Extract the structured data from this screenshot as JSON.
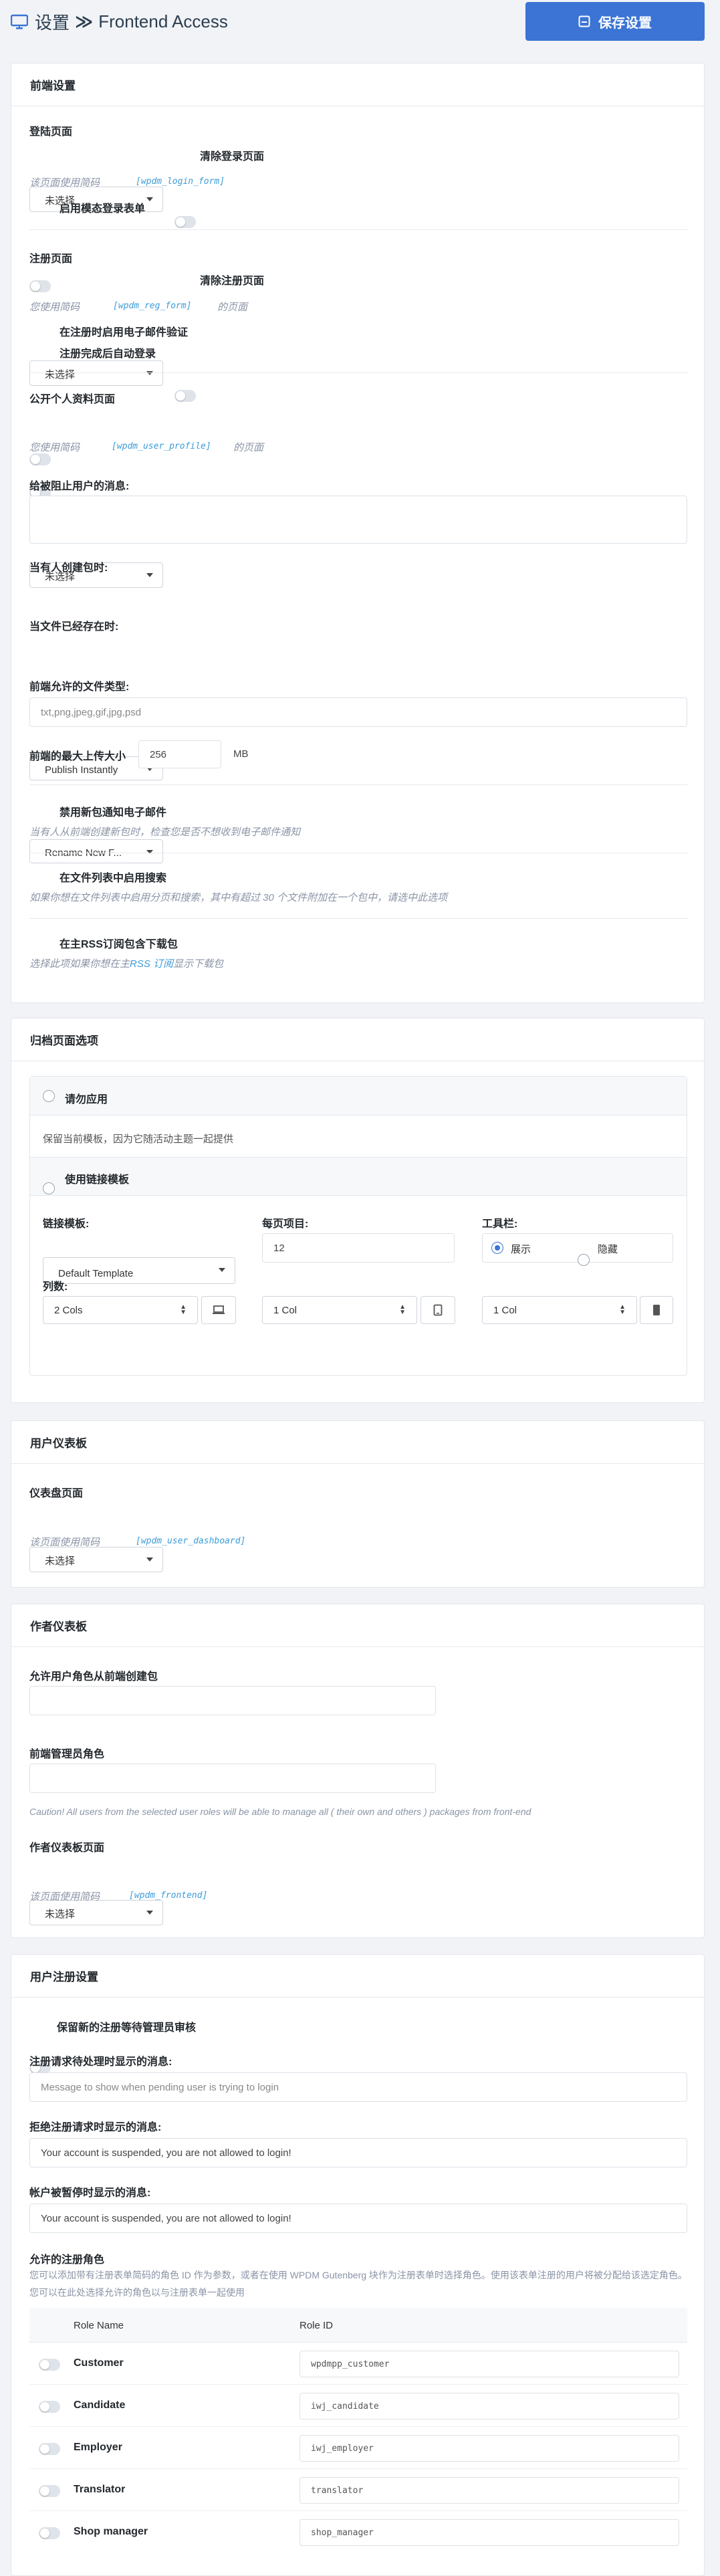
{
  "header": {
    "title_prefix": "设置",
    "title_separator": "≫",
    "title": "Frontend Access",
    "save_label": "保存设置",
    "accent": "#3b74d4"
  },
  "frontend": {
    "section_title": "前端设置",
    "login": {
      "label": "登陆页面",
      "select_value": "未选择",
      "clear_label": "清除登录页面",
      "help": "该页面使用简码",
      "shortcode": "[wpdm_login_form]",
      "modal_label": "启用模态登录表单"
    },
    "register": {
      "label": "注册页面",
      "select_value": "未选择",
      "clear_label": "清除注册页面",
      "help_prefix": "您使用简码",
      "shortcode": "[wpdm_reg_form]",
      "help_suffix": "的页面",
      "email_verify_label": "在注册时启用电子邮件验证",
      "auto_login_label": "注册完成后自动登录"
    },
    "profile": {
      "label": "公开个人资料页面",
      "select_value": "未选择",
      "help_prefix": "您使用简码",
      "shortcode": "[wpdm_user_profile]",
      "help_suffix": "的页面"
    },
    "blocked_msg_label": "给被阻止用户的消息:",
    "create_pkg": {
      "label": "当有人创建包时:",
      "value": "Publish Instantly"
    },
    "file_exists": {
      "label": "当文件已经存在时:",
      "value": "Rename New F..."
    },
    "file_types": {
      "label": "前端允许的文件类型:",
      "value": "txt,png,jpeg,gif,jpg,psd"
    },
    "max_upload": {
      "label": "前端的最大上传大小",
      "value": "256",
      "unit": "MB"
    },
    "new_pkg_email": {
      "label": "禁用新包通知电子邮件",
      "help": "当有人从前端创建新包时，检查您是否不想收到电子邮件通知"
    },
    "file_search": {
      "label": "在文件列表中启用搜索",
      "help": "如果你想在文件列表中启用分页和搜索，其中有超过 30 个文件附加在一个包中，请选中此选项"
    },
    "rss": {
      "label": "在主RSS订阅包含下载包",
      "help_prefix": "选择此项如果你想在主",
      "help_link": "RSS 订阅",
      "help_suffix": "显示下载包"
    }
  },
  "archive": {
    "section_title": "归档页面选项",
    "opt1_label": "请勿应用",
    "opt1_desc": "保留当前模板，因为它随活动主题一起提供",
    "opt2_label": "使用链接模板",
    "link_tpl_label": "链接模板:",
    "link_tpl_value": "Default Template",
    "per_page_label": "每页项目:",
    "per_page_value": "12",
    "toolbar_label": "工具栏:",
    "toolbar_show": "展示",
    "toolbar_hide": "隐藏",
    "columns_label": "列数:",
    "cols_desktop": "2 Cols",
    "cols_tablet": "1 Col",
    "cols_mobile": "1 Col"
  },
  "user_dashboard": {
    "section_title": "用户仪表板",
    "label": "仪表盘页面",
    "select_value": "未选择",
    "help": "该页面使用简码",
    "shortcode": "[wpdm_user_dashboard]"
  },
  "author_dashboard": {
    "section_title": "作者仪表板",
    "roles_label": "允许用户角色从前端创建包",
    "manager_label": "前端管理员角色",
    "caution": "Caution! All users from the selected user roles will be able to manage all ( their own and others ) packages from front-end",
    "page_label": "作者仪表板页面",
    "select_value": "未选择",
    "help": "该页面使用简码",
    "shortcode": "[wpdm_frontend]"
  },
  "registration": {
    "section_title": "用户注册设置",
    "hold_label": "保留新的注册等待管理员审核",
    "pending_label": "注册请求待处理时显示的消息:",
    "pending_placeholder": "Message to show when pending user is trying to login",
    "rejected_label": "拒绝注册请求时显示的消息:",
    "rejected_value": "Your account is suspended, you are not allowed to login!",
    "paused_label": "帐户被暂停时显示的消息:",
    "paused_value": "Your account is suspended, you are not allowed to login!",
    "roles_title": "允许的注册角色",
    "roles_help": "您可以添加带有注册表单简码的角色 ID 作为参数，或者在使用 WPDM Gutenberg 块作为注册表单时选择角色。使用该表单注册的用户将被分配给该选定角色。您可以在此处选择允许的角色以与注册表单一起使用",
    "col_name": "Role Name",
    "col_id": "Role ID",
    "roles": [
      {
        "name": "Customer",
        "id": "wpdmpp_customer"
      },
      {
        "name": "Candidate",
        "id": "iwj_candidate"
      },
      {
        "name": "Employer",
        "id": "iwj_employer"
      },
      {
        "name": "Translator",
        "id": "translator"
      },
      {
        "name": "Shop manager",
        "id": "shop_manager"
      }
    ]
  }
}
